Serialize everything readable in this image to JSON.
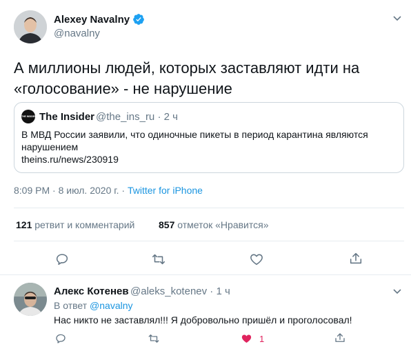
{
  "tweet": {
    "author_name": "Alexey Navalny",
    "author_handle": "@navalny",
    "text_line1": "А миллионы людей, которых заставляют идти на",
    "text_line2": "«голосование» - не нарушение",
    "quote": {
      "avatar_text": "THE INSIDER",
      "author_name": "The Insider",
      "author_handle": "@the_ins_ru",
      "separator": "·",
      "time": "2 ч",
      "text_line1": "В МВД России заявили, что одиночные пикеты в период карантина являются",
      "text_line2": "нарушением",
      "link": "theins.ru/news/230919"
    },
    "timestamp": "8:09 PM · 8 июл. 2020 г. ·",
    "source": "Twitter for iPhone",
    "stats": {
      "retweets_count": "121",
      "retweets_label": "ретвит и комментарий",
      "likes_count": "857",
      "likes_label": "отметок «Нравится»"
    }
  },
  "reply": {
    "author_name": "Алекс Котенев",
    "author_handle": "@aleks_kotenev",
    "separator": "·",
    "time": "1 ч",
    "in_reply_prefix": "В ответ",
    "in_reply_handle": "@navalny",
    "text": "Нас никто не заставлял!!! Я добровольно пришёл и проголосовал!",
    "like_count": "1"
  },
  "colors": {
    "accent": "#1b95e0",
    "muted": "#657786",
    "heart": "#e0245e",
    "border": "#e6ecf0"
  }
}
